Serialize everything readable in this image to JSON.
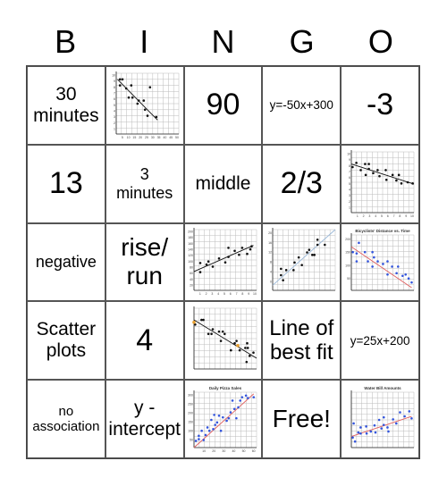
{
  "header": {
    "letters": [
      "B",
      "I",
      "N",
      "G",
      "O"
    ]
  },
  "cells": [
    {
      "id": "r1c1",
      "text": "30 minutes"
    },
    {
      "id": "r1c2",
      "image": "scatter-plot-negative-trend",
      "text": ""
    },
    {
      "id": "r1c3",
      "text": "90"
    },
    {
      "id": "r1c4",
      "text": "y=-50x+300"
    },
    {
      "id": "r1c5",
      "text": "-3"
    },
    {
      "id": "r2c1",
      "text": "13"
    },
    {
      "id": "r2c2",
      "text": "3 minutes"
    },
    {
      "id": "r2c3",
      "text": "middle"
    },
    {
      "id": "r2c4",
      "text": "2/3"
    },
    {
      "id": "r2c5",
      "image": "scatter-plot-weak-negative-trend",
      "text": ""
    },
    {
      "id": "r3c1",
      "text": "negative"
    },
    {
      "id": "r3c2",
      "text": "rise/ run"
    },
    {
      "id": "r3c3",
      "image": "scatter-plot-positive-trend",
      "text": ""
    },
    {
      "id": "r3c4",
      "image": "scatter-plot-positive-trend-2",
      "text": ""
    },
    {
      "id": "r3c5",
      "image": "scatter-plot-bicyclists-distance-vs-time",
      "title": "Bicyclists' Distance vs. Time",
      "text": ""
    },
    {
      "id": "r4c1",
      "text": "Scatter plots"
    },
    {
      "id": "r4c2",
      "text": "4"
    },
    {
      "id": "r4c3",
      "image": "scatter-plot-negative-trend-with-points",
      "text": ""
    },
    {
      "id": "r4c4",
      "text": "Line of best fit"
    },
    {
      "id": "r4c5",
      "text": "y=25x+200"
    },
    {
      "id": "r5c1",
      "text": "no association"
    },
    {
      "id": "r5c2",
      "text": "y - intercept"
    },
    {
      "id": "r5c3",
      "image": "scatter-plot-daily-pizza-sales",
      "title": "Daily Pizza Sales",
      "text": ""
    },
    {
      "id": "r5c4",
      "text": "Free!"
    },
    {
      "id": "r5c5",
      "image": "scatter-plot-water-bill-amounts",
      "title": "Water Bill Amounts",
      "text": ""
    }
  ],
  "plots": {
    "r1c2": {
      "yticks": [
        "10",
        "9",
        "8",
        "7",
        "6",
        "5",
        "4",
        "3",
        "2",
        "1"
      ],
      "xticks": [
        "5",
        "10",
        "15",
        "20",
        "25",
        "30",
        "35",
        "40",
        "45",
        "50"
      ],
      "points": [
        [
          3,
          9
        ],
        [
          5,
          9
        ],
        [
          3,
          8
        ],
        [
          8,
          7.5
        ],
        [
          10,
          6
        ],
        [
          12,
          8
        ],
        [
          13,
          6
        ],
        [
          18,
          5.5
        ],
        [
          17,
          5
        ],
        [
          22,
          5.5
        ],
        [
          23,
          4
        ],
        [
          25,
          3
        ],
        [
          27,
          7.7
        ],
        [
          32,
          2.8
        ]
      ],
      "line": [
        [
          1,
          9
        ],
        [
          33,
          2.3
        ]
      ],
      "xmax": 50,
      "ymax": 10,
      "dot": "#111",
      "linecolor": "#111"
    },
    "r2c5": {
      "yticks": [
        "10",
        "9",
        "8",
        "7",
        "6",
        "5",
        "4",
        "3",
        "2",
        "1"
      ],
      "xticks": [
        "1",
        "2",
        "3",
        "4",
        "5",
        "6",
        "7",
        "8",
        "9",
        "10"
      ],
      "points": [
        [
          0.2,
          7.5
        ],
        [
          0.8,
          8.2
        ],
        [
          1.5,
          7
        ],
        [
          2.2,
          8
        ],
        [
          2.3,
          6.2
        ],
        [
          2.8,
          8
        ],
        [
          2.8,
          7.2
        ],
        [
          3.5,
          6.5
        ],
        [
          4.2,
          7
        ],
        [
          4.5,
          6
        ],
        [
          5.5,
          7
        ],
        [
          5.6,
          5.4
        ],
        [
          6.6,
          6.2
        ],
        [
          7.2,
          5.3
        ],
        [
          7.6,
          6.2
        ],
        [
          8,
          4.8
        ],
        [
          9,
          5
        ],
        [
          9.8,
          4.8
        ]
      ],
      "line": [
        [
          0,
          8
        ],
        [
          10,
          4.7
        ]
      ],
      "xmax": 10,
      "ymax": 10,
      "dot": "#111",
      "linecolor": "#111"
    },
    "r3c3": {
      "yticks": [
        "200",
        "180",
        "160",
        "140",
        "120",
        "100",
        "80",
        "60",
        "40",
        "20"
      ],
      "xticks": [
        "1",
        "2",
        "3",
        "4",
        "5",
        "6",
        "7",
        "8",
        "9",
        "10"
      ],
      "points": [
        [
          1,
          90
        ],
        [
          1,
          60
        ],
        [
          2,
          85
        ],
        [
          2.3,
          95
        ],
        [
          3,
          78
        ],
        [
          4,
          105
        ],
        [
          5,
          92
        ],
        [
          5.5,
          140
        ],
        [
          5.5,
          110
        ],
        [
          6.5,
          130
        ],
        [
          7.2,
          117
        ],
        [
          7.7,
          140
        ],
        [
          8.5,
          120
        ],
        [
          9,
          135
        ],
        [
          9.2,
          145
        ]
      ],
      "line": [
        [
          0,
          62
        ],
        [
          9.5,
          148
        ]
      ],
      "xmax": 10,
      "ymax": 200,
      "dot": "#111",
      "linecolor": "#111"
    },
    "r3c4": {
      "yticks": [
        "20",
        "16",
        "12",
        "8",
        "4",
        "0"
      ],
      "xticks": [],
      "points": [
        [
          0.8,
          8.5
        ],
        [
          0.8,
          6
        ],
        [
          1,
          4
        ],
        [
          1.3,
          8
        ],
        [
          2,
          8
        ],
        [
          2.1,
          11
        ],
        [
          2.5,
          13
        ],
        [
          2.8,
          10
        ],
        [
          3.3,
          15
        ],
        [
          3.5,
          16
        ],
        [
          3.8,
          14
        ],
        [
          4,
          14
        ],
        [
          4.3,
          20
        ],
        [
          4.3,
          18
        ],
        [
          5,
          18
        ]
      ],
      "line": [
        [
          0,
          2
        ],
        [
          6,
          24
        ]
      ],
      "xmin": 0,
      "xmax": 6,
      "ymin": 0,
      "ymax": 24,
      "dot": "#111",
      "linecolor": "#9ab8d8"
    },
    "r3c5": {
      "yticks": [
        "200",
        "150",
        "100",
        "50"
      ],
      "xticks": [],
      "points": [
        [
          0.2,
          145
        ],
        [
          0.7,
          140
        ],
        [
          1,
          180
        ],
        [
          0.7,
          110
        ],
        [
          1.8,
          145
        ],
        [
          2.2,
          110
        ],
        [
          2.8,
          145
        ],
        [
          3,
          125
        ],
        [
          2.8,
          90
        ],
        [
          3.5,
          110
        ],
        [
          4.2,
          100
        ],
        [
          4.8,
          110
        ],
        [
          4.8,
          60
        ],
        [
          5.4,
          90
        ],
        [
          6,
          65
        ],
        [
          6.2,
          90
        ],
        [
          6.8,
          55
        ],
        [
          7.2,
          60
        ],
        [
          7.6,
          45
        ],
        [
          8,
          30
        ]
      ],
      "line": [
        [
          0,
          165
        ],
        [
          8,
          10
        ]
      ],
      "xmax": 8.3,
      "ymax": 210,
      "dot": "#3355dd",
      "linecolor": "#e06060"
    },
    "r4c3": {
      "yticks": [],
      "xticks": [],
      "points": [
        [
          0,
          10
        ],
        [
          0.2,
          9.5
        ],
        [
          1.2,
          10.5
        ],
        [
          1.5,
          10.5
        ],
        [
          2.3,
          7.5
        ],
        [
          2.8,
          7.5
        ],
        [
          3,
          8.5
        ],
        [
          4,
          8
        ],
        [
          4.3,
          6
        ],
        [
          4.6,
          8
        ],
        [
          4.9,
          7.5
        ],
        [
          5.9,
          4
        ],
        [
          6.5,
          5.5
        ],
        [
          6.8,
          6
        ],
        [
          7.3,
          4
        ],
        [
          8.2,
          4.5
        ],
        [
          8.5,
          5.5
        ],
        [
          8.6,
          4.5
        ],
        [
          8.4,
          1.5
        ],
        [
          8.9,
          2.8
        ],
        [
          9.5,
          3.5
        ]
      ],
      "line": [
        [
          0,
          10.5
        ],
        [
          10,
          2.3
        ]
      ],
      "highlight": [
        [
          0,
          10
        ],
        [
          7,
          5
        ]
      ],
      "xmax": 10,
      "ymax": 13,
      "dot": "#111",
      "linecolor": "#111"
    },
    "r5c3": {
      "yticks": [
        "300",
        "250",
        "200",
        "150",
        "100",
        "50"
      ],
      "xticks": [
        "10",
        "20",
        "30",
        "40",
        "50",
        "60"
      ],
      "points": [
        [
          2,
          40
        ],
        [
          5,
          70
        ],
        [
          5,
          50
        ],
        [
          8,
          100
        ],
        [
          10,
          45
        ],
        [
          12,
          75
        ],
        [
          14,
          120
        ],
        [
          16,
          100
        ],
        [
          18,
          165
        ],
        [
          20,
          110
        ],
        [
          21,
          195
        ],
        [
          22,
          135
        ],
        [
          24,
          150
        ],
        [
          26,
          190
        ],
        [
          28,
          100
        ],
        [
          30,
          180
        ],
        [
          34,
          160
        ],
        [
          36,
          175
        ],
        [
          38,
          210
        ],
        [
          40,
          280
        ],
        [
          42,
          230
        ],
        [
          44,
          175
        ],
        [
          46,
          240
        ],
        [
          48,
          280
        ],
        [
          50,
          300
        ],
        [
          54,
          310
        ],
        [
          56,
          295
        ],
        [
          62,
          300
        ]
      ],
      "line": [
        [
          0,
          0
        ],
        [
          62,
          320
        ]
      ],
      "xmax": 65,
      "ymax": 330,
      "dot": "#3355dd",
      "linecolor": "#e06060"
    },
    "r5c5": {
      "yticks": [],
      "xticks": [],
      "points": [
        [
          0.3,
          20
        ],
        [
          0.5,
          48
        ],
        [
          0.8,
          12
        ],
        [
          1.5,
          30
        ],
        [
          2,
          40
        ],
        [
          2,
          28
        ],
        [
          3.2,
          42
        ],
        [
          3.3,
          28
        ],
        [
          4.2,
          32
        ],
        [
          5,
          44
        ],
        [
          5.2,
          30
        ],
        [
          6,
          55
        ],
        [
          6.5,
          38
        ],
        [
          7,
          60
        ],
        [
          7,
          45
        ],
        [
          7.8,
          40
        ],
        [
          8,
          32
        ],
        [
          9,
          56
        ],
        [
          9.7,
          48
        ],
        [
          10.5,
          70
        ],
        [
          11.5,
          62
        ],
        [
          12.5,
          72
        ],
        [
          13,
          58
        ]
      ],
      "line": [
        [
          0,
          22
        ],
        [
          13,
          62
        ]
      ],
      "xmax": 13.5,
      "ymax": 110,
      "dot": "#3355dd",
      "linecolor": "#e06060"
    }
  }
}
